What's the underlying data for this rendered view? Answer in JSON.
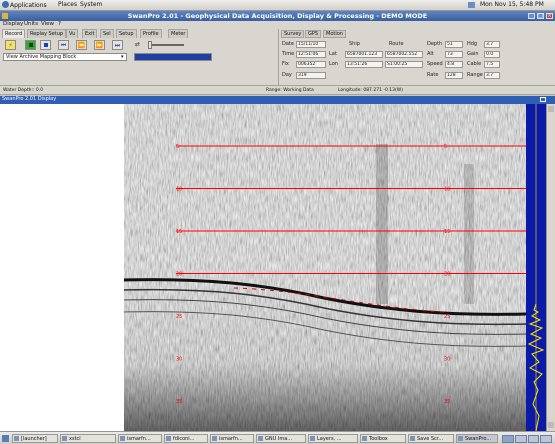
{
  "top_panel": {
    "menus": [
      "Applications",
      "Places",
      "System"
    ],
    "clock": "Mon Nov 15, 5:48 PM"
  },
  "window": {
    "title": "SwanPro 2.01 - Geophysical Data Acquisition, Display & Processing - DEMO MODE"
  },
  "menubar": [
    "Display",
    "Units",
    "View",
    "?"
  ],
  "left_tabs": [
    "Record",
    "Replay Setup",
    "Vu",
    "Exit",
    "Sel",
    "Setup",
    "Profile",
    "Meter"
  ],
  "file_select": "View Archive Mapping Block",
  "info_tabs": [
    "Survey",
    "GPS",
    "Motion"
  ],
  "info": {
    "labels": [
      "Date",
      "Time",
      "Fix",
      "Day",
      "Ship",
      "Route",
      "Lat",
      "Lon",
      "Depth",
      "Alt",
      "Speed",
      "Rate",
      "Hdg",
      "Gain",
      "Cable",
      "Range"
    ],
    "values": [
      "15/11/10",
      "12:51:06",
      "006352",
      "319",
      "6587001.123",
      "6587002.552",
      "13:51:26",
      "S1:00:25",
      "51",
      "73",
      "4.8",
      "128",
      "3.7",
      "0.0",
      "7.5",
      "3.7"
    ]
  },
  "status": {
    "left": "Water Depth:: 0.0",
    "middle": "Range: Working Data",
    "right": "Longitude: 087.271 -0.13(W)"
  },
  "viewer_title": "SwanPro 2.01 Display",
  "sonar": {
    "depth_marks": [
      "5",
      "10",
      "15",
      "20",
      "25",
      "30",
      "35",
      "40",
      "45"
    ]
  },
  "taskbar": {
    "items": [
      "[launcher]",
      "xstcl",
      "ismarfn...",
      "fdiconi...",
      "ismarfn...",
      "GNU Ima...",
      "Layers, ...",
      "Toolbox",
      "Save Scr...",
      "SwanPro..."
    ]
  },
  "colors": {
    "title_bar": "#3a5f9f",
    "progress": "#1f3fa6",
    "depth_line": "#ff0000",
    "trace_bg": "#0b1ba8",
    "trace_signal": "#ffe800"
  }
}
